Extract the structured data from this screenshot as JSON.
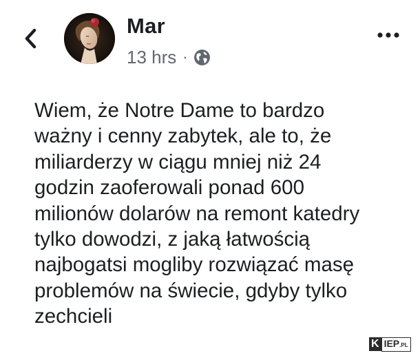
{
  "post": {
    "author": "Mar",
    "time": "13 hrs",
    "separator": "·",
    "privacy_icon": "globe-icon",
    "text": "Wiem, że Notre Dame to bardzo\nważny i cenny zabytek, ale to, że\nmiliarderzy w ciągu mniej niż 24\ngodzin zaoferowali ponad 600\nmilionów dolarów na remont katedry\ntylko dowodzi, z jaką łatwością\nnajbogatsi mogliby rozwiązać masę\nproblemów na świecie, gdyby tylko\nzechcieli"
  },
  "icons": {
    "back": "chevron-left-icon",
    "more": "more-options-icon"
  },
  "watermark": {
    "k": "K",
    "rest": "IEP",
    "suffix": ".PL"
  },
  "colors": {
    "text": "#1c1e21",
    "meta": "#606770"
  }
}
